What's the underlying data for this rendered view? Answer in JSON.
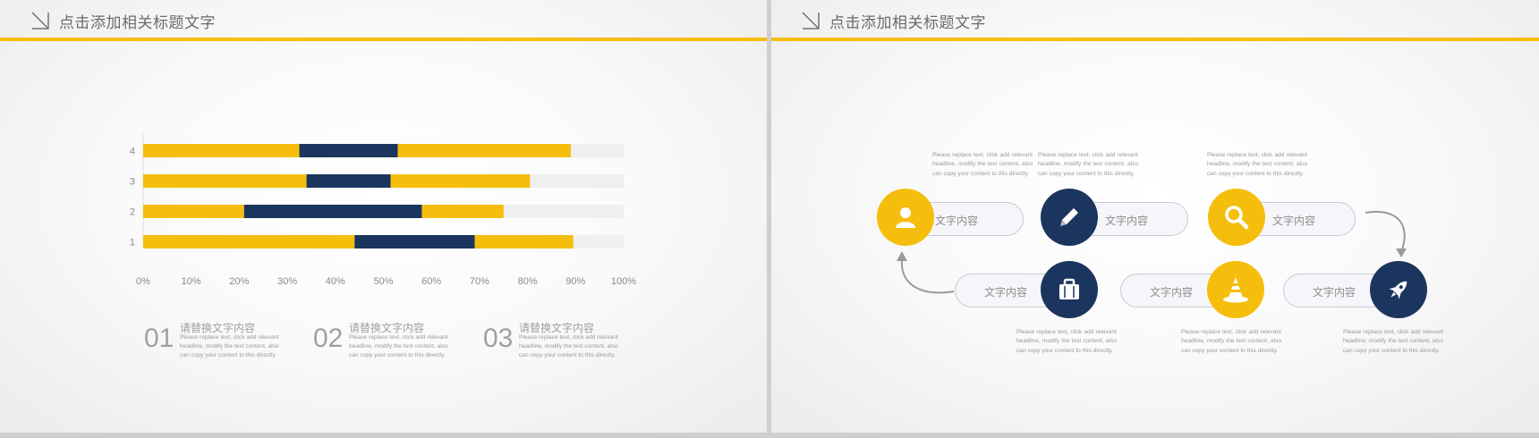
{
  "left_slide": {
    "title": "点击添加相关标题文字",
    "legend": [
      {
        "num": "01",
        "heading": "请替换文字内容",
        "desc": "Please replace text, click add relevant headline, modify the text content, also can copy your content to this directly."
      },
      {
        "num": "02",
        "heading": "请替换文字内容",
        "desc": "Please replace text, click add relevant headline, modify the text content, also can copy your content to this directly."
      },
      {
        "num": "03",
        "heading": "请替换文字内容",
        "desc": "Please replace text, click add relevant headline, modify the text content, also can copy your content to this directly."
      }
    ]
  },
  "right_slide": {
    "title": "点击添加相关标题文字",
    "steps": [
      {
        "label": "文字内容",
        "icon": "user-icon",
        "desc": "Please replace text, click add relevant headline, modify the text content, also can copy your content to this directly."
      },
      {
        "label": "文字内容",
        "icon": "pencil-icon",
        "desc": "Please replace text, click add relevant headline, modify the text content, also can copy your content to this directly."
      },
      {
        "label": "文字内容",
        "icon": "search-icon",
        "desc": "Please replace text, click add relevant headline, modify the text content, also can copy your content to this directly."
      },
      {
        "label": "文字内容",
        "icon": "briefcase-icon",
        "desc": "Please replace text, click add relevant headline, modify the text content, also can copy your content to this directly."
      },
      {
        "label": "文字内容",
        "icon": "traffic-cone-icon",
        "desc": "Please replace text, click add relevant headline, modify the text content, also can copy your content to this directly."
      },
      {
        "label": "文字内容",
        "icon": "rocket-icon",
        "desc": "Please replace text, click add relevant headline, modify the text content, also can copy your content to this directly."
      }
    ]
  },
  "colors": {
    "accent": "#f5be0d",
    "navy": "#1c355e",
    "track": "#efefef"
  },
  "chart_data": {
    "type": "bar",
    "orientation": "horizontal",
    "stacked": true,
    "categories": [
      "1",
      "2",
      "3",
      "4"
    ],
    "series": [
      {
        "values": [
          44,
          21,
          34,
          32.5
        ],
        "color": "#f5be0d"
      },
      {
        "values": [
          25,
          37,
          17.5,
          20.5
        ],
        "color": "#1c355e"
      },
      {
        "values": [
          20.5,
          17,
          29,
          36
        ],
        "color": "#f5be0d"
      }
    ],
    "x_ticks": [
      "0%",
      "10%",
      "20%",
      "30%",
      "40%",
      "50%",
      "60%",
      "70%",
      "80%",
      "90%",
      "100%"
    ],
    "xlim": [
      0,
      100
    ],
    "xlabel": "",
    "ylabel": "",
    "title": "",
    "grid": false
  }
}
